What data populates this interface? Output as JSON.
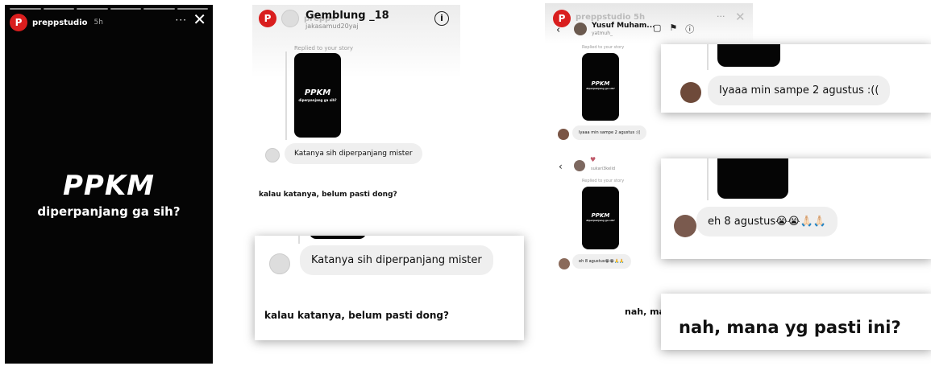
{
  "story": {
    "username": "preppstudio",
    "time": "5h",
    "more": "···",
    "close": "✕",
    "logo_letter": "P",
    "title": "PPKM",
    "subtitle": "diperpanjang ga sih?"
  },
  "dm1": {
    "ghost_username": "prepps",
    "name": "Gemblung _18",
    "handle": "jakasamud20yaj",
    "replied_label": "Replied to your story",
    "phone_title": "PPKM",
    "phone_sub": "diperpanjang ga sih?",
    "message": "Katanya sih diperpanjang mister",
    "caption": "kalau katanya, belum pasti dong?"
  },
  "zoom1": {
    "message": "Katanya sih diperpanjang mister",
    "caption": "kalau katanya, belum pasti dong?"
  },
  "dm2": {
    "ghost_username": "preppstudio",
    "ghost_time": "5h",
    "name": "Yusuf Muham...",
    "handle": "yatmuh_",
    "replied_label": "Replied to your story",
    "phone_title": "PPKM",
    "phone_sub": "diperpanjang ga sih?",
    "message1": "Iyaaa min sampe 2 agustus :((",
    "handle2": "sukari3kelid",
    "message2": "eh 8 agustus😭😭🙏🙏",
    "cut_caption": "nah, ma"
  },
  "zoom2": {
    "message": "Iyaaa min sampe 2 agustus :(("
  },
  "zoom3": {
    "message": "eh 8 agustus😭😭🙏🏻🙏🏻"
  },
  "zoom4": {
    "caption": "nah, mana yg pasti ini?"
  },
  "icons": {
    "back": "‹",
    "video": "▢",
    "flag": "⚑",
    "info": "i"
  }
}
